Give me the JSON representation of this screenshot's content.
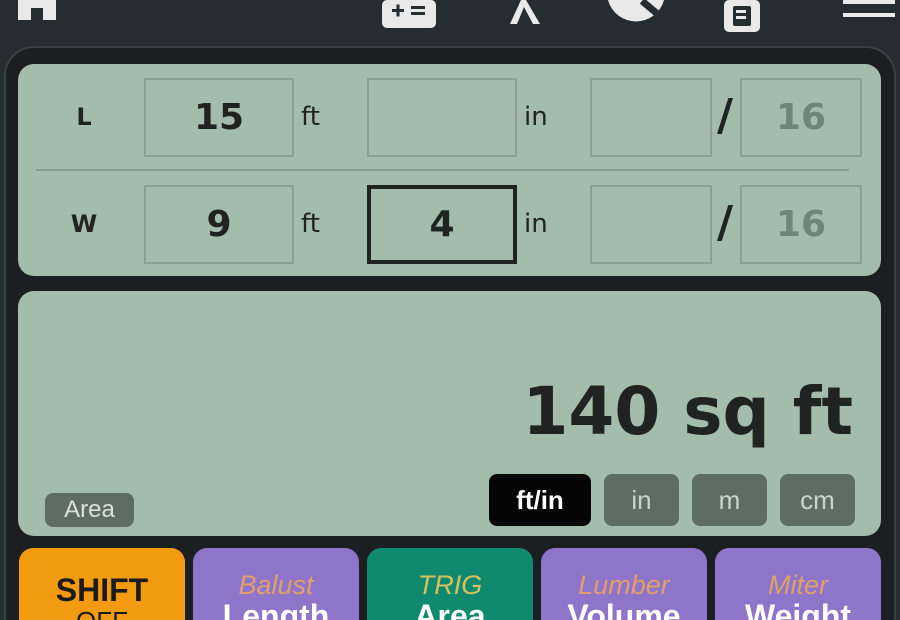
{
  "nav": {
    "icons": [
      "home-icon",
      "calculator-add-icon",
      "lambda-icon",
      "search-icon",
      "notes-icon",
      "menu-icon"
    ]
  },
  "inputs": {
    "rows": [
      {
        "label": "L",
        "feet": "15",
        "feet_unit": "ft",
        "inches": "",
        "inch_unit": "in",
        "numerator": "",
        "slash": "/",
        "denominator": "16"
      },
      {
        "label": "W",
        "feet": "9",
        "feet_unit": "ft",
        "inches": "4",
        "inch_unit": "in",
        "numerator": "",
        "slash": "/",
        "denominator": "16"
      }
    ]
  },
  "result": {
    "value": "140 sq ft",
    "mode": "Area",
    "units": [
      "ft/in",
      "in",
      "m",
      "cm"
    ],
    "selected_unit": "ft/in"
  },
  "keys": [
    {
      "sub": "OFF",
      "main": "SHIFT"
    },
    {
      "sub": "Balust",
      "main": "Length"
    },
    {
      "sub": "TRIG",
      "main": "Area"
    },
    {
      "sub": "Lumber",
      "main": "Volume"
    },
    {
      "sub": "Miter",
      "main": "Weight"
    }
  ],
  "colors": {
    "background": "#262d31",
    "display": "#a4bcab",
    "shift_key": "#f29a10",
    "purple_key": "#8e75c9",
    "green_key": "#0f8a6e",
    "selected_unit": "#050505"
  }
}
